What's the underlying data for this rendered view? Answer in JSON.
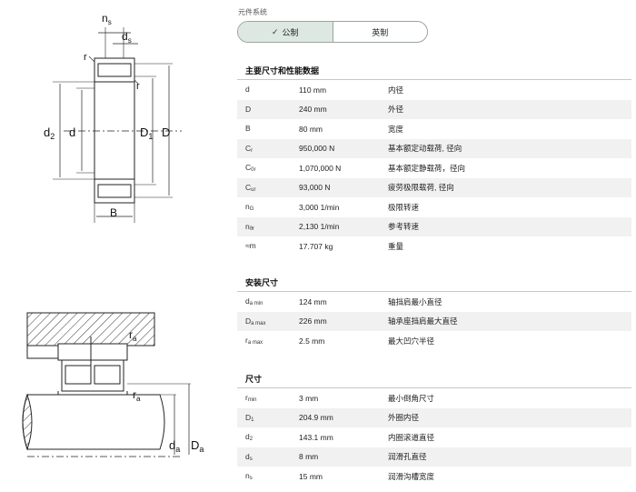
{
  "diagrams": {
    "top": {
      "labels": {
        "ns": "n",
        "ns_sub": "s",
        "ds": "d",
        "ds_sub": "s",
        "r1": "r",
        "r2": "r",
        "d2": "d",
        "d2_sub": "2",
        "d": "d",
        "D1": "D",
        "D1_sub": "1",
        "D": "D",
        "B": "B"
      }
    },
    "bottom": {
      "labels": {
        "ra1": "r",
        "ra1_sub": "a",
        "ra2": "r",
        "ra2_sub": "a",
        "da": "d",
        "da_sub": "a",
        "Da": "D",
        "Da_sub": "a"
      }
    }
  },
  "unit_caption": "元件系统",
  "units": {
    "metric": "公制",
    "imperial": "英制",
    "check_icon": "check-icon"
  },
  "sections": {
    "main": {
      "title": "主要尺寸和性能数据",
      "rows": [
        {
          "sym": "d",
          "sub": "",
          "val": "110 mm",
          "desc": "内径"
        },
        {
          "sym": "D",
          "sub": "",
          "val": "240 mm",
          "desc": "外径"
        },
        {
          "sym": "B",
          "sub": "",
          "val": "80 mm",
          "desc": "宽度"
        },
        {
          "sym": "C",
          "sub": "r",
          "val": "950,000 N",
          "desc": "基本额定动载荷, 径向"
        },
        {
          "sym": "C",
          "sub": "0r",
          "val": "1,070,000 N",
          "desc": "基本额定静载荷，径向"
        },
        {
          "sym": "C",
          "sub": "ur",
          "val": "93,000 N",
          "desc": "疲劳极限载荷, 径向"
        },
        {
          "sym": "n",
          "sub": "G",
          "val": "3,000 1/min",
          "desc": "极限转速"
        },
        {
          "sym": "n",
          "sub": "ϑr",
          "val": "2,130 1/min",
          "desc": "参考转速"
        },
        {
          "sym": "≈m",
          "sub": "",
          "val": "17.707 kg",
          "desc": "重量"
        }
      ]
    },
    "mounting": {
      "title": "安装尺寸",
      "rows": [
        {
          "sym": "d",
          "sub": "a min",
          "val": "124 mm",
          "desc": "轴挡肩最小直径"
        },
        {
          "sym": "D",
          "sub": "a max",
          "val": "226 mm",
          "desc": "轴承座挡肩最大直径"
        },
        {
          "sym": "r",
          "sub": "a max",
          "val": "2.5 mm",
          "desc": "最大凹穴半径"
        }
      ]
    },
    "dimensions": {
      "title": "尺寸",
      "rows": [
        {
          "sym": "r",
          "sub": "min",
          "val": "3 mm",
          "desc": "最小倒角尺寸"
        },
        {
          "sym": "D",
          "sub": "1",
          "val": "204.9 mm",
          "desc": "外圈内径"
        },
        {
          "sym": "d",
          "sub": "2",
          "val": "143.1 mm",
          "desc": "内圈滚道直径"
        },
        {
          "sym": "d",
          "sub": "s",
          "val": "8 mm",
          "desc": "润滑孔直径"
        },
        {
          "sym": "n",
          "sub": "s",
          "val": "15 mm",
          "desc": "润滑沟槽宽度"
        }
      ]
    }
  }
}
